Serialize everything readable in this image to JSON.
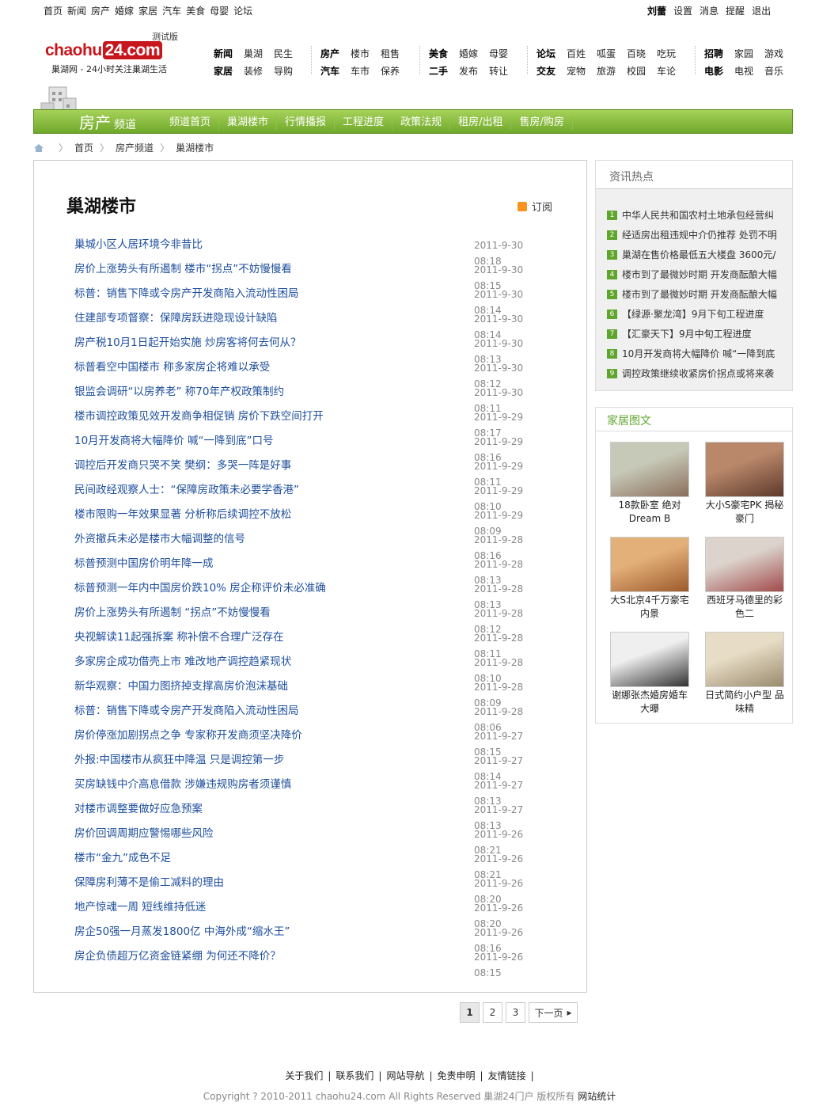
{
  "topnav": [
    "首页",
    "新闻",
    "房产",
    "婚嫁",
    "家居",
    "汽车",
    "美食",
    "母婴",
    "论坛"
  ],
  "user": {
    "name": "刘蕾",
    "links": [
      "设置",
      "消息",
      "提醒",
      "退出"
    ]
  },
  "logo": {
    "beta": "测试版",
    "brand_a": "chaohu",
    "brand_b": "24.com",
    "slogan": "巢湖网 - 24小时关注巢湖生活"
  },
  "mainnav": [
    {
      "rows": [
        [
          "新闻",
          "巢湖",
          "民生"
        ],
        [
          "家居",
          "装修",
          "导购"
        ]
      ]
    },
    {
      "rows": [
        [
          "房产",
          "楼市",
          "租售"
        ],
        [
          "汽车",
          "车市",
          "保养"
        ]
      ]
    },
    {
      "rows": [
        [
          "美食",
          "婚嫁",
          "母婴"
        ],
        [
          "二手",
          "发布",
          "转让"
        ]
      ]
    },
    {
      "rows": [
        [
          "论坛",
          "百姓",
          "呱蛋",
          "百晓",
          "吃玩"
        ],
        [
          "交友",
          "宠物",
          "旅游",
          "校园",
          "车论"
        ]
      ]
    },
    {
      "rows": [
        [
          "招聘",
          "家园",
          "游戏"
        ],
        [
          "电影",
          "电视",
          "音乐"
        ]
      ]
    }
  ],
  "channel": {
    "title": "房产",
    "sub": "频道",
    "tabs": [
      "频道首页",
      "巢湖楼市",
      "行情播报",
      "工程进度",
      "政策法规",
      "租房/出租",
      "售房/购房"
    ]
  },
  "crumb": [
    "首页",
    "房产频道",
    "巢湖楼市"
  ],
  "page_title": "巢湖楼市",
  "rss_label": "订阅",
  "news": [
    {
      "t": "巢城小区人居环境今非昔比",
      "d": "2011-9-30 08:18"
    },
    {
      "t": "房价上涨势头有所遏制 楼市“拐点”不妨慢慢看",
      "d": "2011-9-30 08:15"
    },
    {
      "t": "标普：销售下降或令房产开发商陷入流动性困局",
      "d": "2011-9-30 08:14"
    },
    {
      "t": "住建部专项督察：保障房跃进隐现设计缺陷",
      "d": "2011-9-30 08:14"
    },
    {
      "t": "房产税10月1日起开始实施 炒房客将何去何从？",
      "d": "2011-9-30 08:13"
    },
    {
      "t": "标普看空中国楼市 称多家房企将难以承受",
      "d": "2011-9-30 08:12"
    },
    {
      "t": "银监会调研“以房养老” 称70年产权政策制约",
      "d": "2011-9-30 08:11"
    },
    {
      "t": "楼市调控政策见效开发商争相促销 房价下跌空间打开",
      "d": "2011-9-29 08:17"
    },
    {
      "t": "10月开发商将大幅降价 喊“一降到底”口号",
      "d": "2011-9-29 08:16"
    },
    {
      "t": "调控后开发商只哭不笑 樊纲：多哭一阵是好事",
      "d": "2011-9-29 08:11"
    },
    {
      "t": "民间政经观察人士：“保障房政策未必要学香港”",
      "d": "2011-9-29 08:10"
    },
    {
      "t": "楼市限购一年效果显著 分析称后续调控不放松",
      "d": "2011-9-29 08:09"
    },
    {
      "t": "外资撤兵未必是楼市大幅调整的信号",
      "d": "2011-9-28 08:16"
    },
    {
      "t": "标普预测中国房价明年降一成",
      "d": "2011-9-28 08:13"
    },
    {
      "t": "标普预测一年内中国房价跌10% 房企称评价未必准确",
      "d": "2011-9-28 08:13"
    },
    {
      "t": "房价上涨势头有所遏制 “拐点”不妨慢慢看",
      "d": "2011-9-28 08:12"
    },
    {
      "t": "央视解读11起强拆案 称补偿不合理广泛存在",
      "d": "2011-9-28 08:11"
    },
    {
      "t": "多家房企成功借壳上市 难改地产调控趋紧现状",
      "d": "2011-9-28 08:10"
    },
    {
      "t": "新华观察：中国力图挤掉支撑高房价泡沫基础",
      "d": "2011-9-28 08:09"
    },
    {
      "t": "标普：销售下降或令房产开发商陷入流动性困局",
      "d": "2011-9-28 08:06"
    },
    {
      "t": "房价停涨加剧拐点之争 专家称开发商须坚决降价",
      "d": "2011-9-27 08:15"
    },
    {
      "t": "外报:中国楼市从疯狂中降温 只是调控第一步",
      "d": "2011-9-27 08:14"
    },
    {
      "t": "买房缺钱中介高息借款 涉嫌违规购房者须谨慎",
      "d": "2011-9-27 08:13"
    },
    {
      "t": "对楼市调整要做好应急预案",
      "d": "2011-9-27 08:13"
    },
    {
      "t": "房价回调周期应警惕哪些风险",
      "d": "2011-9-26 08:21"
    },
    {
      "t": "楼市“金九”成色不足",
      "d": "2011-9-26 08:21"
    },
    {
      "t": "保障房利薄不是偷工减料的理由",
      "d": "2011-9-26 08:20"
    },
    {
      "t": "地产惊魂一周 短线维持低迷",
      "d": "2011-9-26 08:20"
    },
    {
      "t": "房企50强一月蒸发1800亿 中海外成“缩水王”",
      "d": "2011-9-26 08:16"
    },
    {
      "t": "房企负债超万亿资金链紧绷 为何还不降价？",
      "d": "2011-9-26 08:15"
    }
  ],
  "pager": {
    "pages": [
      "1",
      "2",
      "3"
    ],
    "current": "1",
    "next": "下一页"
  },
  "hot": {
    "title": "资讯热点",
    "items": [
      "中华人民共和国农村土地承包经营纠",
      "经适房出租违规中介仍推荐 处罚不明",
      "巢湖在售价格最低五大楼盘 3600元/",
      "楼市到了最微妙时期 开发商酝酿大幅",
      "楼市到了最微妙时期 开发商酝酿大幅",
      "【绿源·聚龙湾】9月下旬工程进度",
      "【汇豪天下】9月中旬工程进度",
      "10月开发商将大幅降价 喊“一降到底",
      "调控政策继续收紧房价拐点或将来袭"
    ]
  },
  "gallery": {
    "title": "家居图文",
    "items": [
      {
        "cap": "18款卧室 绝对Dream B",
        "colors": [
          "#c7c9b8",
          "#8a6f5b"
        ]
      },
      {
        "cap": "大小S豪宅PK 揭秘豪门",
        "colors": [
          "#b9876a",
          "#5d3a2c"
        ]
      },
      {
        "cap": "大S北京4千万豪宅内景",
        "colors": [
          "#e4b07a",
          "#9c5a2a"
        ]
      },
      {
        "cap": "西班牙马德里的彩色二",
        "colors": [
          "#dcd3cc",
          "#a04a4a"
        ]
      },
      {
        "cap": "谢娜张杰婚房婚车大曝",
        "colors": [
          "#efefef",
          "#333333"
        ]
      },
      {
        "cap": "日式简约小户型 品味精",
        "colors": [
          "#e7dcc5",
          "#9a8b6e"
        ]
      }
    ]
  },
  "footer": {
    "links": [
      "关于我们",
      "联系我们",
      "网站导航",
      "免责申明",
      "友情链接"
    ],
    "copy": "Copyright ? 2010-2011 chaohu24.com All Rights Reserved 巢湖24门户 版权所有",
    "stat": "网站统计"
  },
  "colors": {
    "green": "#6fa82a",
    "link": "#1d4e9c",
    "red": "#c8161d"
  }
}
